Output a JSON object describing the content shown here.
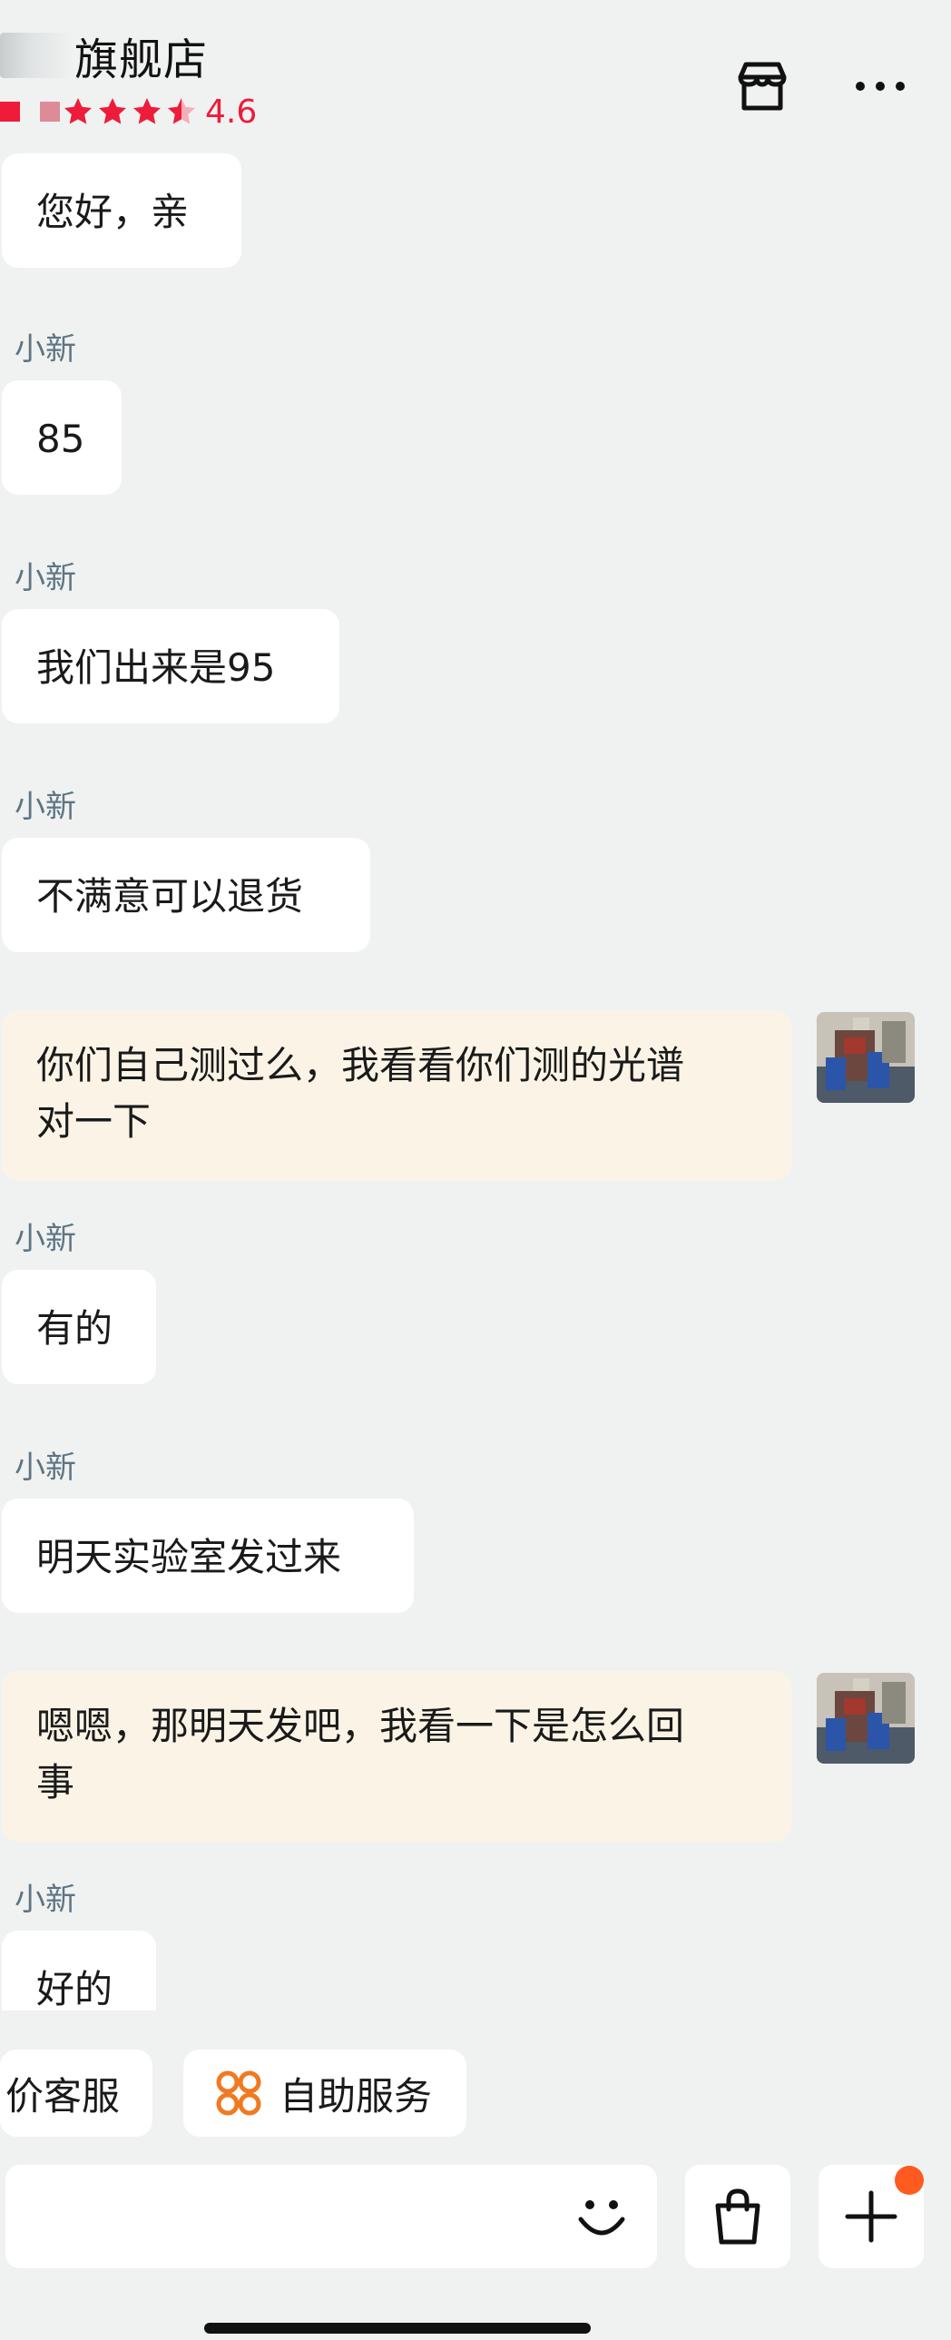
{
  "header": {
    "store_name": "旗舰店",
    "rating": "4.6",
    "rating_stars": 4.5,
    "shop_icon": "store-icon",
    "more_icon": "more-icon"
  },
  "messages": [
    {
      "from": "shop",
      "sender": "",
      "text": "您好，亲"
    },
    {
      "from": "shop",
      "sender": "小新",
      "text": "85"
    },
    {
      "from": "shop",
      "sender": "小新",
      "text": "我们出来是95"
    },
    {
      "from": "shop",
      "sender": "小新",
      "text": "不满意可以退货"
    },
    {
      "from": "me",
      "sender": "",
      "text_line1": "你们自己测过么，我看看你们测的光谱",
      "text_line2": "对一下"
    },
    {
      "from": "shop",
      "sender": "小新",
      "text": "有的"
    },
    {
      "from": "shop",
      "sender": "小新",
      "text": "明天实验室发过来"
    },
    {
      "from": "me",
      "sender": "",
      "text_line1": "嗯嗯，那明天发吧，我看一下是怎么回",
      "text_line2": "事"
    },
    {
      "from": "shop",
      "sender": "小新",
      "text": "好的"
    }
  ],
  "quick_actions": [
    {
      "label": "价客服"
    },
    {
      "label": "自助服务",
      "icon": "self-service-icon"
    }
  ],
  "input": {
    "placeholder": "",
    "emoji_icon": "smile-icon",
    "bag_icon": "shopping-bag-icon",
    "plus_icon": "plus-icon"
  },
  "colors": {
    "background": "#eff2f1",
    "accent_red": "#ee1c3a",
    "my_bubble": "#fbf4e6",
    "badge_orange": "#ff5a1f",
    "self_service_icon": "#f07a22"
  }
}
